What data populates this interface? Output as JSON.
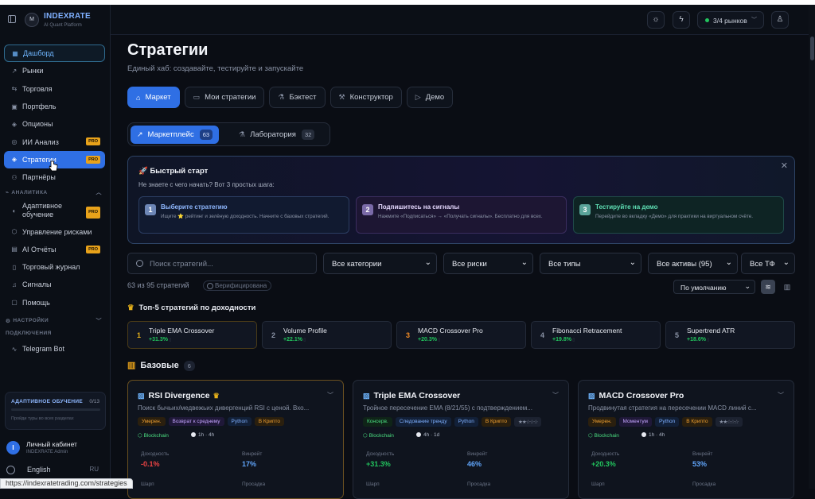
{
  "sidebar": {
    "logo_text": "M",
    "brand": "INDEXRATE",
    "tagline": "AI Quant Platform",
    "nav": [
      {
        "label": "Дашборд",
        "icon": "grid-icon"
      },
      {
        "label": "Рынки",
        "icon": "trend-icon"
      },
      {
        "label": "Торговля",
        "icon": "swap-icon"
      },
      {
        "label": "Портфель",
        "icon": "briefcase-icon"
      },
      {
        "label": "Опционы",
        "icon": "layers-icon"
      },
      {
        "label": "ИИ Анализ",
        "icon": "globe-icon",
        "badge": "PRO"
      },
      {
        "label": "Стратегии",
        "icon": "layers-icon",
        "badge": "PRO"
      },
      {
        "label": "Партнёры",
        "icon": "users-icon"
      }
    ],
    "section_analytics": "АНАЛИТИКА",
    "analytics": [
      {
        "label": "Адаптивное обучение",
        "icon": "book-icon",
        "badge": "PRO"
      },
      {
        "label": "Управление рисками",
        "icon": "shield-icon"
      },
      {
        "label": "AI Отчёты",
        "icon": "doc-icon",
        "badge": "PRO"
      },
      {
        "label": "Торговый журнал",
        "icon": "journal-icon"
      },
      {
        "label": "Сигналы",
        "icon": "bell-icon"
      },
      {
        "label": "Помощь",
        "icon": "help-icon"
      }
    ],
    "section_settings": "НАСТРОЙКИ",
    "section_connections": "ПОДКЛЮЧЕНИЯ",
    "connections": [
      {
        "label": "Telegram Bot",
        "icon": "pulse-icon"
      }
    ],
    "learning": {
      "title": "АДАПТИВНОЕ ОБУЧЕНИЕ",
      "count": "0/13",
      "progress": 0,
      "hint": "Пройди туры во всех разделах"
    },
    "profile": {
      "initial": "I",
      "name": "Личный кабинет",
      "role": "INDEXRATE Admin"
    },
    "language": {
      "label": "English",
      "code": "RU"
    }
  },
  "header": {
    "markets_label": "3/4 рынков",
    "market_status_color": "#22c55e"
  },
  "page": {
    "title": "Стратегии",
    "subtitle": "Единый хаб: создавайте, тестируйте и запускайте",
    "tabs": [
      {
        "label": "Маркет",
        "icon": "store-icon",
        "active": true
      },
      {
        "label": "Мои стратегии",
        "icon": "folder-icon"
      },
      {
        "label": "Бэктест",
        "icon": "flask-icon"
      },
      {
        "label": "Конструктор",
        "icon": "wrench-icon"
      },
      {
        "label": "Демо",
        "icon": "play-icon"
      }
    ],
    "subtabs": [
      {
        "label": "Маркетплейс",
        "count": "63",
        "active": true
      },
      {
        "label": "Лаборатория",
        "count": "32"
      }
    ]
  },
  "quickstart": {
    "title": "🚀 Быстрый старт",
    "subtitle": "Не знаете с чего начать? Вот 3 простых шага:",
    "steps": [
      {
        "num": "1",
        "title": "Выберите стратегию",
        "desc": "Ищите ⭐ рейтинг и зелёную доходность. Начните с базовых стратегий."
      },
      {
        "num": "2",
        "title": "Подпишитесь на сигналы",
        "desc": "Нажмите «Подписаться» → «Получать сигналы». Бесплатно для всех."
      },
      {
        "num": "3",
        "title": "Тестируйте на демо",
        "desc": "Перейдите во вкладку «Демо» для практики на виртуальном счёте."
      }
    ]
  },
  "filters": {
    "search_placeholder": "Поиск стратегий...",
    "category": "Все категории",
    "risk": "Все риски",
    "type": "Все типы",
    "assets": "Все активы (95)",
    "timeframe": "Все ТФ",
    "count_text": "63 из 95 стратегий",
    "verified_label": "Верифицирована",
    "sort": "По умолчанию"
  },
  "top5": {
    "title": "Топ-5 стратегий по доходности",
    "items": [
      {
        "rank": "1",
        "name": "Triple EMA Crossover",
        "pct": "+31.3%"
      },
      {
        "rank": "2",
        "name": "Volume Profile",
        "pct": "+22.1%"
      },
      {
        "rank": "3",
        "name": "MACD Crossover Pro",
        "pct": "+20.3%"
      },
      {
        "rank": "4",
        "name": "Fibonacci Retracement",
        "pct": "+19.8%"
      },
      {
        "rank": "5",
        "name": "Supertrend ATR",
        "pct": "+18.6%"
      }
    ]
  },
  "basic": {
    "title": "Базовые",
    "count": "6",
    "labels": {
      "yield": "Доходность",
      "winrate": "Винрейт",
      "sharpe": "Шарп",
      "drawdown": "Просадка"
    },
    "cards": [
      {
        "name": "RSI Divergence",
        "desc": "Поиск бычьих/медвежьих дивергенций RSI с ценой. Вхо...",
        "tags": [
          "Умерен.",
          "Возврат к среднему",
          "Python",
          "В Крипто"
        ],
        "chain": "Blockchain",
        "tf": "1h · 4h",
        "yield": "-0.1%",
        "winrate": "17%"
      },
      {
        "name": "Triple EMA Crossover",
        "desc": "Тройное пересечение EMA (8/21/55) с подтверждением...",
        "tags": [
          "Консерв.",
          "Следование тренду",
          "Python",
          "В Крипто"
        ],
        "chain": "Blockchain",
        "tf": "4h · 1d",
        "yield": "+31.3%",
        "winrate": "46%"
      },
      {
        "name": "MACD Crossover Pro",
        "desc": "Продвинутая стратегия на пересечении MACD линий с...",
        "tags": [
          "Умерен.",
          "Моментум",
          "Python",
          "В Крипто"
        ],
        "chain": "Blockchain",
        "tf": "1h · 4h",
        "yield": "+20.3%",
        "winrate": "53%"
      }
    ]
  },
  "statusbar": {
    "url": "https://indexratetrading.com/strategies"
  }
}
